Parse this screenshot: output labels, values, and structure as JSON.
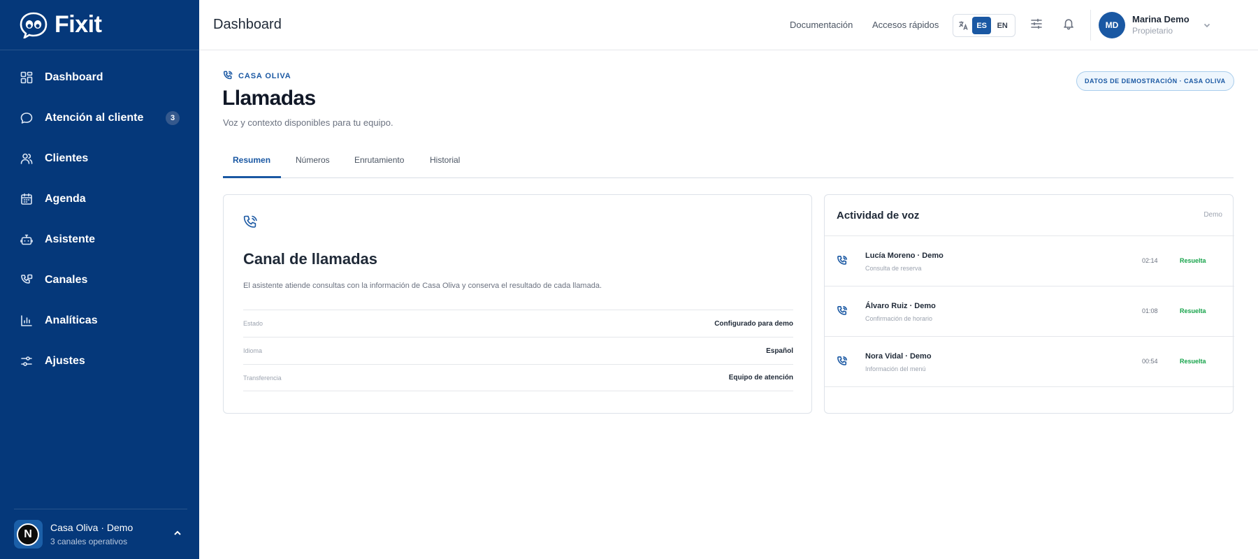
{
  "app": {
    "name": "Fixit"
  },
  "sidebar": {
    "items": [
      {
        "label": "Dashboard",
        "icon": "dashboard-icon"
      },
      {
        "label": "Atención al cliente",
        "icon": "chat-icon",
        "badge": "3"
      },
      {
        "label": "Clientes",
        "icon": "users-icon"
      },
      {
        "label": "Agenda",
        "icon": "calendar-icon"
      },
      {
        "label": "Asistente",
        "icon": "bot-icon"
      },
      {
        "label": "Canales",
        "icon": "channels-icon"
      },
      {
        "label": "Analíticas",
        "icon": "analytics-icon"
      },
      {
        "label": "Ajustes",
        "icon": "settings-icon"
      }
    ],
    "workspace": {
      "avatar_letter": "N",
      "name": "Casa Oliva · Demo",
      "subtitle": "3 canales operativos"
    }
  },
  "header": {
    "title": "Dashboard",
    "links": {
      "docs": "Documentación",
      "shortcuts": "Accesos rápidos"
    },
    "languages": {
      "active": "ES",
      "other": "EN"
    },
    "user": {
      "initials": "MD",
      "name": "Marina Demo",
      "role": "Propietario"
    }
  },
  "page": {
    "eyebrow": "CASA OLIVA",
    "title": "Llamadas",
    "subtitle": "Voz y contexto disponibles para tu equipo.",
    "demo_badge": "DATOS DE DEMOSTRACIÓN · CASA OLIVA",
    "tabs": [
      "Resumen",
      "Números",
      "Enrutamiento",
      "Historial"
    ],
    "active_tab": "Resumen"
  },
  "channel_card": {
    "title": "Canal de llamadas",
    "description": "El asistente atiende consultas con la información de Casa Oliva y conserva el resultado de cada llamada.",
    "rows": [
      {
        "key": "Estado",
        "value": "Configurado para demo"
      },
      {
        "key": "Idioma",
        "value": "Español"
      },
      {
        "key": "Transferencia",
        "value": "Equipo de atención"
      }
    ]
  },
  "activity": {
    "title": "Actividad de voz",
    "tag": "Demo",
    "items": [
      {
        "name": "Lucía Moreno · Demo",
        "subtitle": "Consulta de reserva",
        "duration": "02:14",
        "status": "Resuelta"
      },
      {
        "name": "Álvaro Ruiz · Demo",
        "subtitle": "Confirmación de horario",
        "duration": "01:08",
        "status": "Resuelta"
      },
      {
        "name": "Nora Vidal · Demo",
        "subtitle": "Información del menú",
        "duration": "00:54",
        "status": "Resuelta"
      }
    ]
  },
  "colors": {
    "sidebar_bg": "#05387a",
    "accent": "#1a58a3",
    "success": "#16a34a"
  }
}
